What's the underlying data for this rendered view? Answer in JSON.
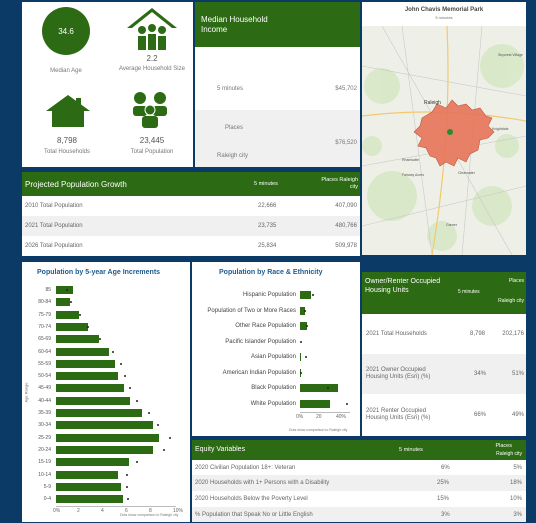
{
  "stats": {
    "median_age": {
      "value": "34.6",
      "label": "Median Age"
    },
    "household_size": {
      "value": "2.2",
      "label": "Average Household Size"
    },
    "total_households": {
      "value": "8,798",
      "label": "Total Households"
    },
    "total_population": {
      "value": "23,445",
      "label": "Total Population"
    }
  },
  "income": {
    "title": "Median Household Income",
    "row1_label": "5 minutes",
    "row1_value": "$45,702",
    "row2_label_a": "Places",
    "row2_label_b": "Raleigh city",
    "row2_value": "$76,520"
  },
  "map": {
    "title": "John Chavis Memorial Park",
    "subtitle": "5 minutes",
    "places": [
      "Skycrest Village",
      "Raleigh",
      "Knightdale",
      "Rhamkatte",
      "Garner",
      "Fairway Acres",
      "Clearwater"
    ]
  },
  "growth": {
    "title": "Projected Population Growth",
    "col1": "5 minutes",
    "col2": "Places Raleigh city",
    "rows": [
      {
        "label": "2010 Total Population",
        "v1": "22,666",
        "v2": "407,090"
      },
      {
        "label": "2021 Total Population",
        "v1": "23,735",
        "v2": "480,766"
      },
      {
        "label": "2026 Total Population",
        "v1": "25,834",
        "v2": "509,978"
      }
    ]
  },
  "age_chart": {
    "title": "Population by 5-year Age Increments",
    "ylabel": "Age Range",
    "footnote": "Dots show comparison to Raleigh city",
    "xticks": [
      "0%",
      "2",
      "4",
      "6",
      "8",
      "10%"
    ]
  },
  "race_chart": {
    "title": "Population by Race & Ethnicity",
    "footnote": "Dots show comparison to Raleigh city",
    "xticks": [
      "0%",
      "20",
      "40%"
    ]
  },
  "chart_data": [
    {
      "type": "bar",
      "title": "Population by 5-year Age Increments",
      "ylabel": "Age Range",
      "categories": [
        "85",
        "80-84",
        "75-79",
        "70-74",
        "65-69",
        "60-64",
        "55-59",
        "50-54",
        "45-49",
        "40-44",
        "35-39",
        "30-34",
        "25-29",
        "20-24",
        "15-19",
        "10-14",
        "5-9",
        "0-4"
      ],
      "series": [
        {
          "values": [
            1.4,
            1.2,
            1.9,
            2.7,
            3.6,
            4.4,
            4.9,
            5.2,
            5.7,
            6.2,
            7.2,
            8.1,
            8.6,
            8.1,
            6.1,
            5.2,
            5.4,
            5.6
          ]
        },
        {
          "values": [
            0.8,
            1.2,
            1.9,
            2.6,
            3.6,
            4.7,
            5.3,
            5.7,
            6.1,
            6.7,
            7.7,
            8.4,
            9.4,
            8.9,
            6.7,
            5.8,
            5.8,
            5.9
          ]
        }
      ],
      "xlim": [
        0,
        10
      ]
    },
    {
      "type": "bar",
      "title": "Population by Race & Ethnicity",
      "categories": [
        "Hispanic Population",
        "Population of Two or More Races",
        "Other Race Population",
        "Pacific Islander Population",
        "Asian Population",
        "American Indian Population",
        "Black Population",
        "White Population"
      ],
      "series": [
        {
          "values": [
            11,
            5,
            7,
            0,
            1,
            0.5,
            38,
            30
          ]
        },
        {
          "values": [
            12,
            4,
            6,
            0,
            5,
            0.4,
            27,
            46
          ]
        }
      ],
      "xlim": [
        0,
        50
      ]
    }
  ],
  "tenure": {
    "title": "Owner/Renter Occupied Housing Units",
    "col1": "5 minutes",
    "col2_a": "Places",
    "col2_b": "Raleigh city",
    "rows": [
      {
        "label": "2021 Total Households",
        "v1": "8,798",
        "v2": "202,176"
      },
      {
        "label": "2021 Owner Occupied Housing Units (Esri) (%)",
        "v1": "34%",
        "v2": "51%"
      },
      {
        "label": "2021 Renter Occupied Housing Units (Esri) (%)",
        "v1": "66%",
        "v2": "49%"
      }
    ]
  },
  "equity": {
    "title": "Equity Variables",
    "col1": "5 minutes",
    "col2_a": "Places",
    "col2_b": "Raleigh city",
    "rows": [
      {
        "label": "2020 Civilian Population 18+: Veteran",
        "v1": "6%",
        "v2": "5%"
      },
      {
        "label": "2020 Households with 1+ Persons with a Disability",
        "v1": "25%",
        "v2": "18%"
      },
      {
        "label": "2020 Households Below the Poverty Level",
        "v1": "15%",
        "v2": "10%"
      },
      {
        "label": "% Population that Speak No or Little English",
        "v1": "3%",
        "v2": "3%"
      }
    ]
  },
  "colors": {
    "brand_green": "#2d6a14",
    "background": "#0b3a66",
    "map_area": "#e8745a"
  }
}
